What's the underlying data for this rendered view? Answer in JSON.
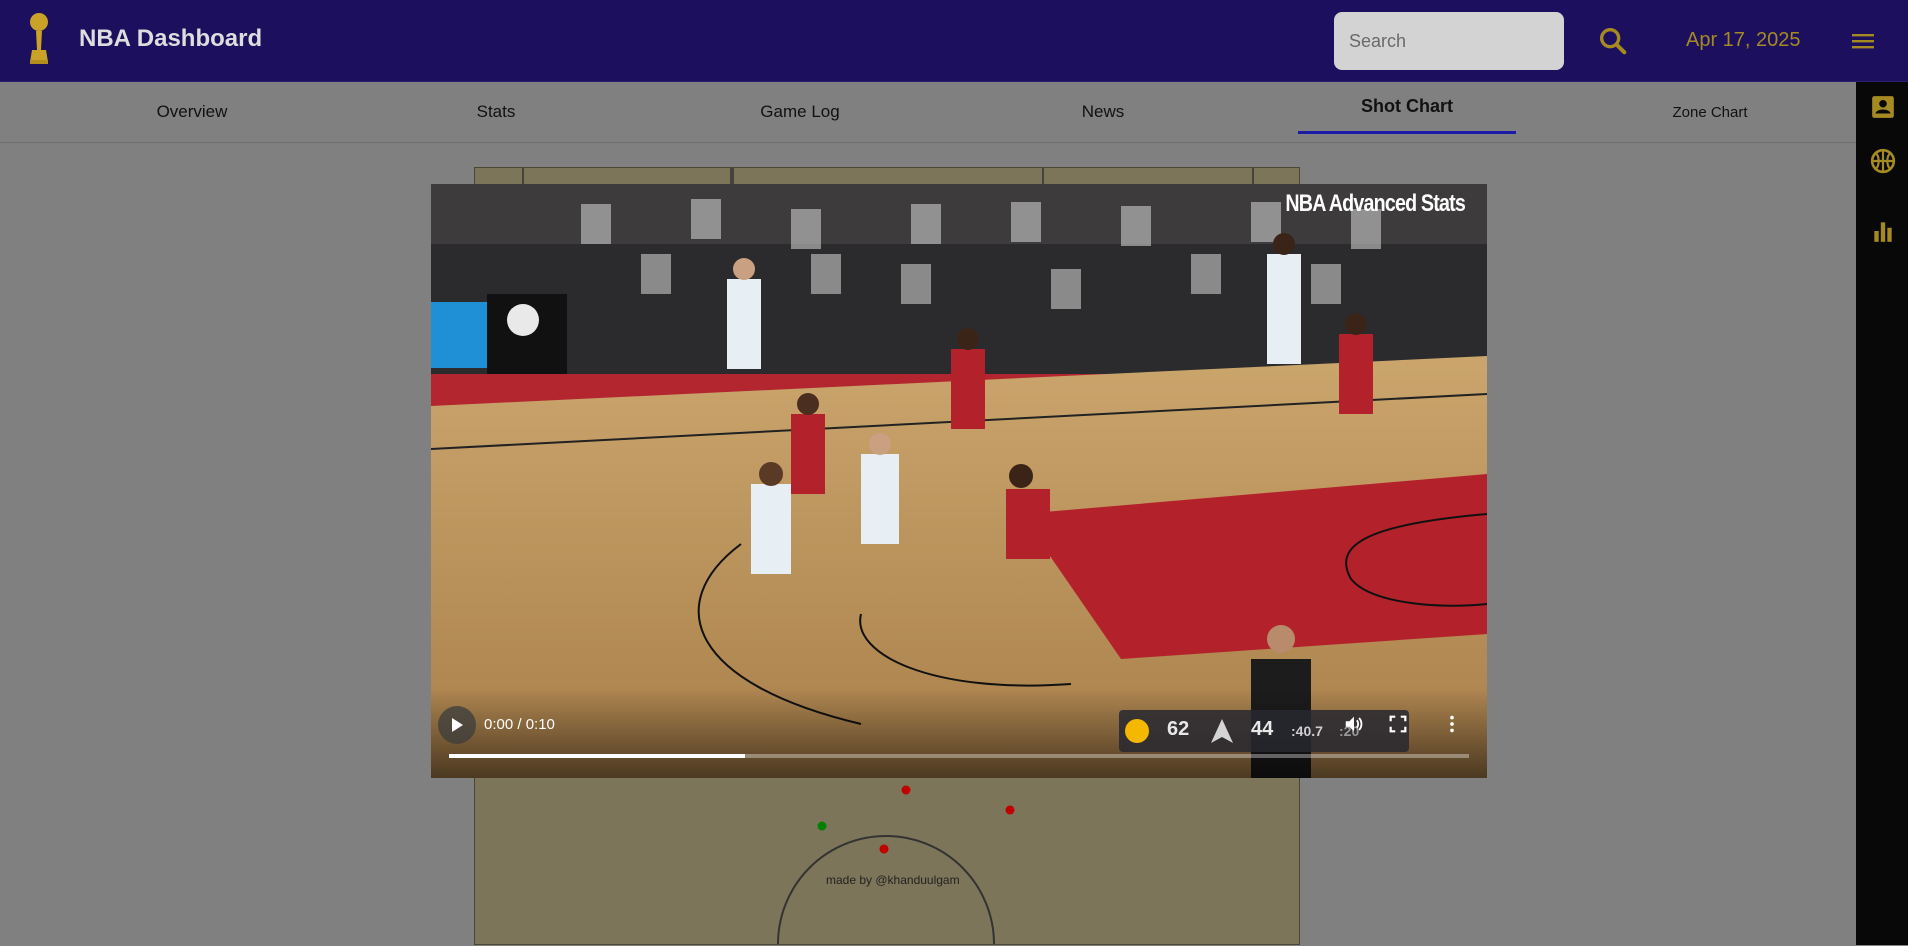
{
  "header": {
    "title": "NBA Dashboard",
    "search_placeholder": "Search",
    "date": "Apr 17, 2025",
    "colors": {
      "bar": "#1b0f5e",
      "accent": "#a58a22"
    }
  },
  "tabs": [
    {
      "label": "Overview"
    },
    {
      "label": "Stats"
    },
    {
      "label": "Game Log"
    },
    {
      "label": "News"
    },
    {
      "label": "Shot Chart",
      "active": true
    },
    {
      "label": "Zone Chart"
    }
  ],
  "side_rail": {
    "icons": [
      "player-card-icon",
      "basketball-icon",
      "bar-chart-icon"
    ]
  },
  "shot_chart": {
    "credit": "made by @khanduulgam",
    "shots": [
      {
        "result": "miss",
        "color": "#c00000"
      },
      {
        "result": "miss",
        "color": "#c00000"
      },
      {
        "result": "make",
        "color": "#008000"
      },
      {
        "result": "miss",
        "color": "#c00000"
      }
    ]
  },
  "video": {
    "watermark": "NBA Advanced Stats",
    "time": "0:00 / 0:10",
    "progress": 0.29,
    "scorebug": {
      "away_score": "62",
      "home_score": "44",
      "clock": ":40.7",
      "shot_clock": ":20"
    }
  }
}
